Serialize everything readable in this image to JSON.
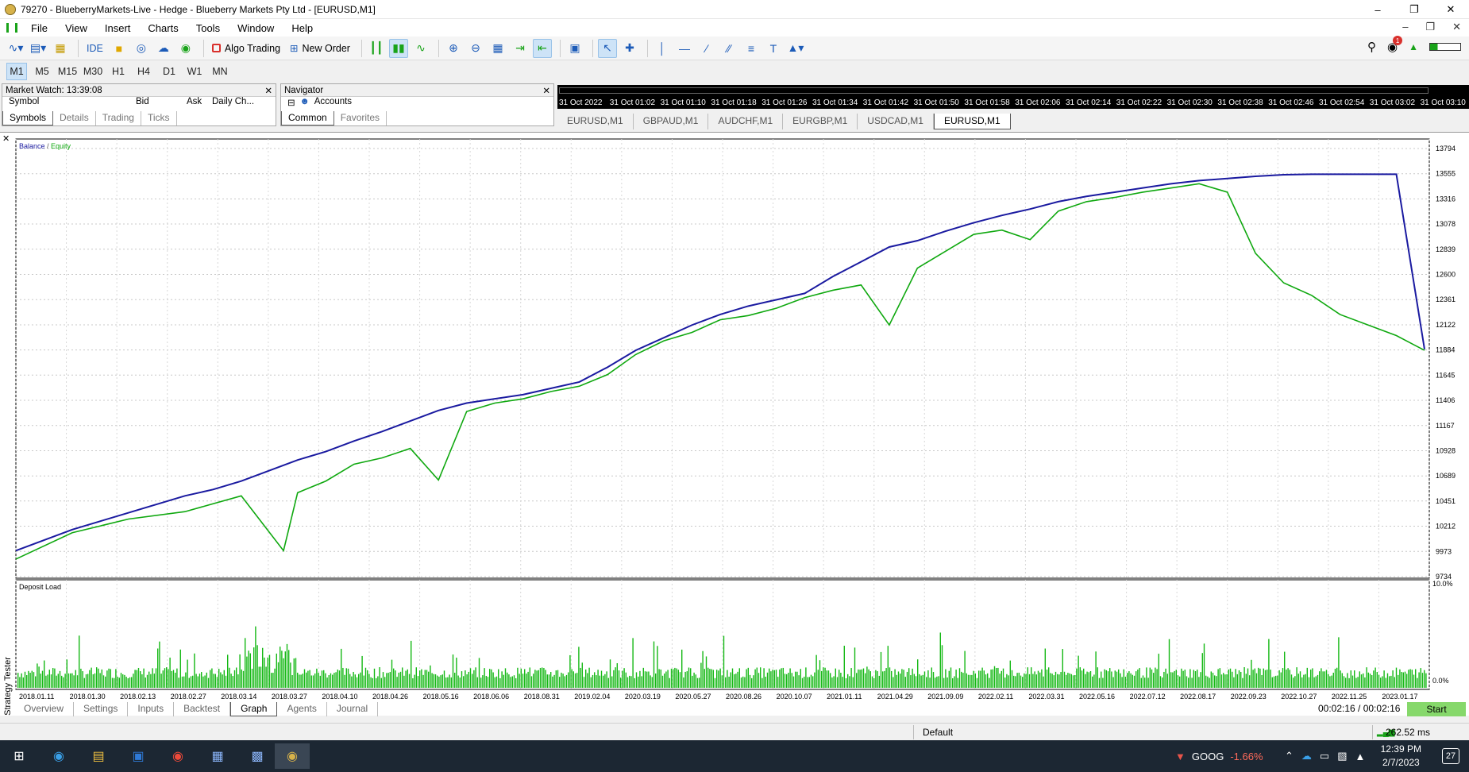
{
  "window": {
    "title": "79270 - BlueberryMarkets-Live - Hedge - Blueberry Markets Pty Ltd - [EURUSD,M1]"
  },
  "menu": [
    "File",
    "View",
    "Insert",
    "Charts",
    "Tools",
    "Window",
    "Help"
  ],
  "toolbar": {
    "ide": "IDE",
    "algo": "Algo Trading",
    "new_order": "New Order"
  },
  "periods": [
    "M1",
    "M5",
    "M15",
    "M30",
    "H1",
    "H4",
    "D1",
    "W1",
    "MN"
  ],
  "market_watch": {
    "title": "Market Watch: 13:39:08",
    "col_symbol": "Symbol",
    "col_bid": "Bid",
    "col_ask": "Ask",
    "col_daily": "Daily Ch...",
    "tabs": [
      "Symbols",
      "Details",
      "Trading",
      "Ticks"
    ]
  },
  "navigator": {
    "title": "Navigator",
    "accounts": "Accounts",
    "tabs": [
      "Common",
      "Favorites"
    ]
  },
  "strip_labels": [
    "31 Oct 2022",
    "31 Oct 01:02",
    "31 Oct 01:10",
    "31 Oct 01:18",
    "31 Oct 01:26",
    "31 Oct 01:34",
    "31 Oct 01:42",
    "31 Oct 01:50",
    "31 Oct 01:58",
    "31 Oct 02:06",
    "31 Oct 02:14",
    "31 Oct 02:22",
    "31 Oct 02:30",
    "31 Oct 02:38",
    "31 Oct 02:46",
    "31 Oct 02:54",
    "31 Oct 03:02",
    "31 Oct 03:10"
  ],
  "chart_tabs": [
    "EURUSD,M1",
    "GBPAUD,M1",
    "AUDCHF,M1",
    "EURGBP,M1",
    "USDCAD,M1",
    "EURUSD,M1"
  ],
  "chart_data": [
    {
      "type": "line",
      "legend": [
        "Balance",
        "Equity"
      ],
      "colors": {
        "balance": "#1a1aa0",
        "equity": "#0fa80f"
      },
      "y_ticks": [
        13794,
        13555,
        13316,
        13078,
        12839,
        12600,
        12361,
        12122,
        11884,
        11645,
        11406,
        11167,
        10928,
        10689,
        10451,
        10212,
        9973,
        9734
      ],
      "ylim": [
        9734,
        13794
      ],
      "x_labels": [
        "2018.01.11",
        "2018.01.30",
        "2018.02.13",
        "2018.02.27",
        "2018.03.14",
        "2018.03.27",
        "2018.04.10",
        "2018.04.26",
        "2018.05.16",
        "2018.06.06",
        "2018.08.31",
        "2019.02.04",
        "2020.03.19",
        "2020.05.27",
        "2020.08.26",
        "2020.10.07",
        "2021.01.11",
        "2021.04.29",
        "2021.09.09",
        "2022.02.11",
        "2022.03.31",
        "2022.05.16",
        "2022.07.12",
        "2022.08.17",
        "2022.09.23",
        "2022.10.27",
        "2022.11.25",
        "2023.01.17"
      ],
      "series": [
        {
          "name": "Balance",
          "x": [
            0,
            2,
            4,
            6,
            8,
            10,
            12,
            14,
            16,
            18,
            20,
            22,
            24,
            26,
            28,
            30,
            32,
            34,
            36,
            38,
            40,
            42,
            44,
            46,
            48,
            50,
            52,
            54,
            56,
            58,
            60,
            62,
            64,
            66,
            68,
            70,
            72,
            74,
            76,
            78,
            80,
            82,
            84,
            86,
            88,
            90,
            92,
            94,
            96,
            98,
            100
          ],
          "values": [
            9980,
            10080,
            10180,
            10260,
            10340,
            10420,
            10500,
            10560,
            10640,
            10740,
            10840,
            10920,
            11020,
            11110,
            11210,
            11310,
            11380,
            11420,
            11460,
            11520,
            11580,
            11720,
            11880,
            12000,
            12120,
            12220,
            12300,
            12360,
            12420,
            12580,
            12720,
            12860,
            12920,
            13010,
            13090,
            13160,
            13220,
            13290,
            13340,
            13380,
            13420,
            13460,
            13490,
            13510,
            13530,
            13545,
            13550,
            13550,
            13550,
            13550,
            11890
          ]
        },
        {
          "name": "Equity",
          "x": [
            0,
            4,
            8,
            12,
            16,
            19,
            20,
            22,
            24,
            26,
            28,
            30,
            32,
            34,
            36,
            38,
            40,
            42,
            44,
            46,
            48,
            50,
            52,
            54,
            56,
            58,
            60,
            62,
            64,
            66,
            68,
            70,
            72,
            74,
            76,
            78,
            80,
            82,
            84,
            86,
            88,
            90,
            92,
            94,
            96,
            98,
            100
          ],
          "values": [
            9900,
            10150,
            10280,
            10350,
            10500,
            9980,
            10530,
            10640,
            10800,
            10860,
            10950,
            10650,
            11300,
            11380,
            11420,
            11490,
            11540,
            11650,
            11840,
            11970,
            12050,
            12170,
            12210,
            12280,
            12380,
            12450,
            12500,
            12120,
            12660,
            12820,
            12980,
            13020,
            12930,
            13200,
            13290,
            13330,
            13380,
            13420,
            13460,
            13380,
            12800,
            12520,
            12400,
            12220,
            12120,
            12020,
            11880
          ]
        }
      ]
    },
    {
      "type": "bar",
      "title": "Deposit Load",
      "y_ticks": [
        "10.0%",
        "0.0%"
      ],
      "ylim": [
        0,
        10
      ]
    }
  ],
  "bottom_tabs": [
    "Overview",
    "Settings",
    "Inputs",
    "Backtest",
    "Graph",
    "Agents",
    "Journal"
  ],
  "tester": {
    "side_label": "Strategy Tester",
    "timer": "00:02:16 / 00:02:16",
    "start": "Start"
  },
  "status": {
    "profile": "Default",
    "ping": "262.52 ms"
  },
  "taskbar": {
    "ticker": "GOOG",
    "change": "-1.66%",
    "time": "12:39 PM",
    "date": "2/7/2023",
    "notifications": "27"
  }
}
